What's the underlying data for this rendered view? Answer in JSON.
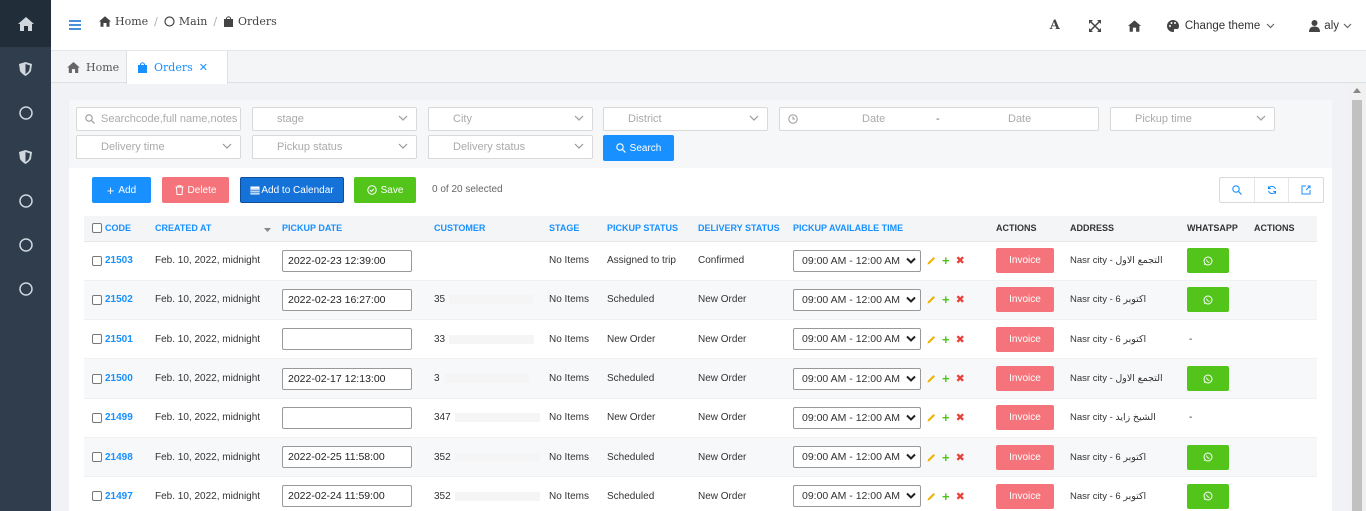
{
  "breadcrumb": [
    {
      "label": "Home"
    },
    {
      "label": "Main"
    },
    {
      "label": "Orders"
    }
  ],
  "topbar": {
    "theme_label": "Change theme",
    "user": "aly"
  },
  "tabs": [
    {
      "label": "Home"
    },
    {
      "label": "Orders"
    }
  ],
  "filters": {
    "search_placeholder": "Searchcode,full name,notes",
    "stage": "stage",
    "city": "City",
    "district": "District",
    "date_from": "Date",
    "date_sep": "-",
    "date_to": "Date",
    "pickup_time": "Pickup time",
    "delivery_time": "Delivery time",
    "pickup_status": "Pickup status",
    "delivery_status": "Delivery status",
    "search_label": "Search"
  },
  "toolbar": {
    "add": "Add",
    "delete": "Delete",
    "calendar": "Add to Calendar",
    "save": "Save",
    "selected": "0 of 20 selected"
  },
  "columns": {
    "code": "CODE",
    "created": "CREATED AT",
    "pickup_date": "PICKUP DATE",
    "customer": "CUSTOMER",
    "stage": "STAGE",
    "pickup_status": "PICKUP STATUS",
    "delivery_status": "DELIVERY STATUS",
    "pickup_time": "PICKUP AVAILABLE TIME",
    "actions": "ACTIONS",
    "address": "ADDRESS",
    "whatsapp": "WHATSAPP",
    "actions2": "ACTIONS"
  },
  "invoice_label": "Invoice",
  "rows": [
    {
      "code": "21503",
      "created": "Feb. 10, 2022, midnight",
      "pickup_date": "2022-02-23 12:39:00",
      "customer": "",
      "stage": "No Items",
      "pickup_status": "Assigned to trip",
      "delivery_status": "Confirmed",
      "time": "09:00 AM - 12:00 AM",
      "address": "Nasr city - التجمع الاول",
      "whatsapp": ""
    },
    {
      "code": "21502",
      "created": "Feb. 10, 2022, midnight",
      "pickup_date": "2022-02-23 16:27:00",
      "customer": "35",
      "stage": "No Items",
      "pickup_status": "Scheduled",
      "delivery_status": "New Order",
      "time": "09:00 AM - 12:00 AM",
      "address": "Nasr city - اكتوبر 6",
      "whatsapp": ""
    },
    {
      "code": "21501",
      "created": "Feb. 10, 2022, midnight",
      "pickup_date": "",
      "customer": "33",
      "stage": "No Items",
      "pickup_status": "New Order",
      "delivery_status": "New Order",
      "time": "09:00 AM - 12:00 AM",
      "address": "Nasr city - اكتوبر 6",
      "whatsapp": "-"
    },
    {
      "code": "21500",
      "created": "Feb. 10, 2022, midnight",
      "pickup_date": "2022-02-17 12:13:00",
      "customer": "3",
      "stage": "No Items",
      "pickup_status": "Scheduled",
      "delivery_status": "New Order",
      "time": "09:00 AM - 12:00 AM",
      "address": "Nasr city - التجمع الاول",
      "whatsapp": ""
    },
    {
      "code": "21499",
      "created": "Feb. 10, 2022, midnight",
      "pickup_date": "",
      "customer": "347",
      "stage": "No Items",
      "pickup_status": "New Order",
      "delivery_status": "New Order",
      "time": "09:00 AM - 12:00 AM",
      "address": "Nasr city - الشيخ زايد",
      "whatsapp": "-"
    },
    {
      "code": "21498",
      "created": "Feb. 10, 2022, midnight",
      "pickup_date": "2022-02-25 11:58:00",
      "customer": "352",
      "stage": "No Items",
      "pickup_status": "Scheduled",
      "delivery_status": "New Order",
      "time": "09:00 AM - 12:00 AM",
      "address": "Nasr city - اكتوبر 6",
      "whatsapp": ""
    },
    {
      "code": "21497",
      "created": "Feb. 10, 2022, midnight",
      "pickup_date": "2022-02-24 11:59:00",
      "customer": "352",
      "stage": "No Items",
      "pickup_status": "Scheduled",
      "delivery_status": "New Order",
      "time": "09:00 AM - 12:00 AM",
      "address": "Nasr city - اكتوبر 6",
      "whatsapp": ""
    }
  ]
}
